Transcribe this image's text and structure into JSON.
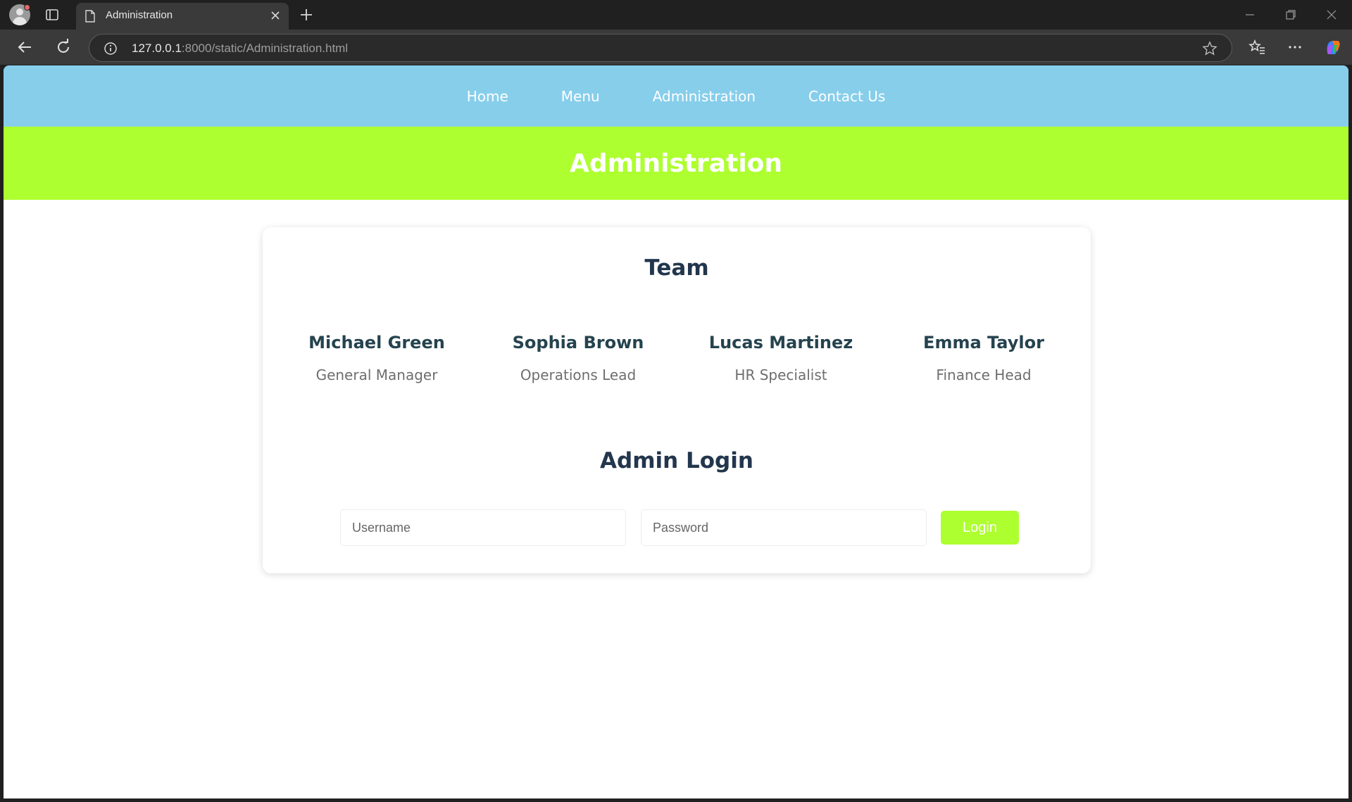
{
  "browser": {
    "tab_title": "Administration",
    "url_host": "127.0.0.1",
    "url_rest": ":8000/static/Administration.html"
  },
  "nav": {
    "items": [
      {
        "label": "Home"
      },
      {
        "label": "Menu"
      },
      {
        "label": "Administration"
      },
      {
        "label": "Contact Us"
      }
    ]
  },
  "hero": {
    "title": "Administration"
  },
  "team": {
    "title": "Team",
    "members": [
      {
        "name": "Michael Green",
        "role": "General Manager"
      },
      {
        "name": "Sophia Brown",
        "role": "Operations Lead"
      },
      {
        "name": "Lucas Martinez",
        "role": "HR Specialist"
      },
      {
        "name": "Emma Taylor",
        "role": "Finance Head"
      }
    ]
  },
  "login": {
    "title": "Admin Login",
    "username_placeholder": "Username",
    "password_placeholder": "Password",
    "button_label": "Login"
  },
  "colors": {
    "nav_bg": "#87ceeb",
    "hero_bg": "#adff2f",
    "heading": "#22364d",
    "member_name": "#25434f",
    "login_button": "#adff2f"
  }
}
